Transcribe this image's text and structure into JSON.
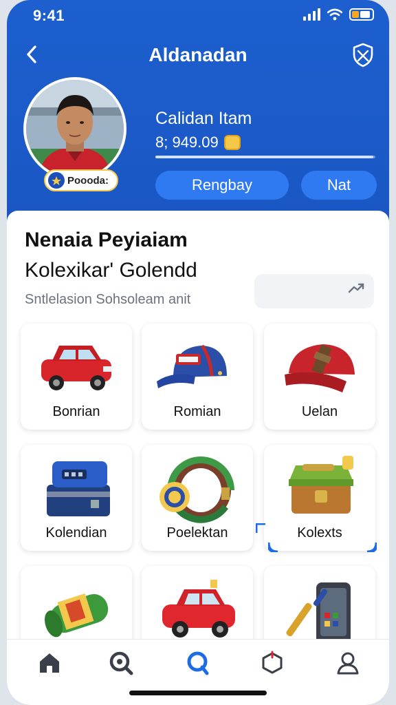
{
  "status": {
    "time": "9:41",
    "icons": [
      "signal-icon",
      "wifi-icon",
      "battery-icon"
    ]
  },
  "navbar": {
    "title": "Aldanadan",
    "back_icon": "chevron-left-icon",
    "action_icon": "shield-icon"
  },
  "profile": {
    "name": "Calidan Itam",
    "points": "8; 949.09",
    "rank_badge": "Poooda:",
    "progress": 0.99,
    "primary_button": "Rengbay",
    "secondary_button": "Nat"
  },
  "section": {
    "title_line1": "Nenaia Peyiaiam",
    "title_line2": "Kolexikar' Golendd",
    "subtitle": "Sntlelasion Sohsoleam anit"
  },
  "items": [
    {
      "label": "Bonrian",
      "icon": "red-car-icon"
    },
    {
      "label": "Romian",
      "icon": "baseball-cap-icon"
    },
    {
      "label": "Uelan",
      "icon": "red-hat-icon"
    },
    {
      "label": "Kolendian",
      "icon": "toolbox-icon"
    },
    {
      "label": "Poelektan",
      "icon": "bracelet-icon"
    },
    {
      "label": "Kolexts",
      "icon": "green-chest-icon"
    },
    {
      "label": "",
      "icon": "canister-icon"
    },
    {
      "label": "",
      "icon": "red-car-icon"
    },
    {
      "label": "",
      "icon": "phone-tool-icon"
    }
  ],
  "tabs": [
    "home-icon",
    "search-icon",
    "discover-icon",
    "collection-icon",
    "profile-icon"
  ],
  "colors": {
    "header_blue": "#1d5fcf",
    "button_blue": "#2f7af0",
    "active_tab": "#1e6be6"
  }
}
